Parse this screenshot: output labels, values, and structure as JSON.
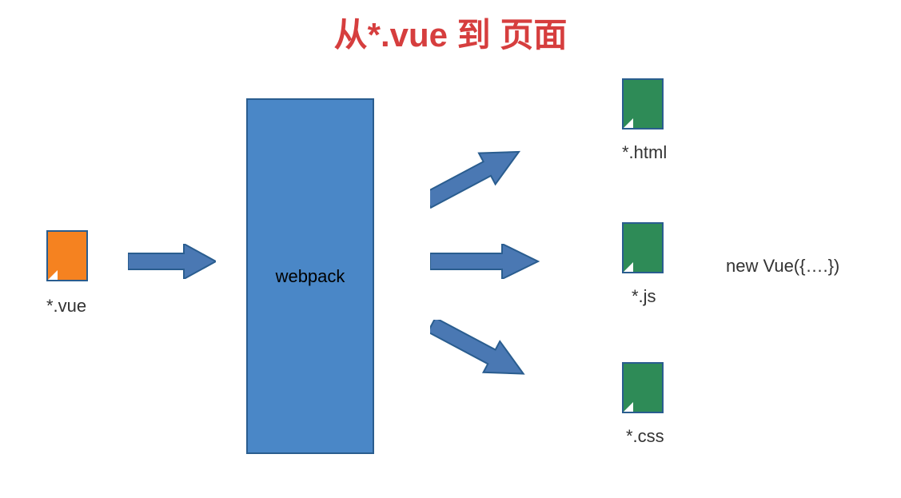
{
  "title": "从*.vue 到 页面",
  "input_label": "*.vue",
  "process_label": "webpack",
  "outputs": {
    "html": "*.html",
    "js": "*.js",
    "css": "*.css"
  },
  "annotation": "new Vue({….})",
  "colors": {
    "title_color": "#d63e3e",
    "orange": "#f58220",
    "green": "#2e8b57",
    "blue_fill": "#4a87c7",
    "blue_stroke": "#2a5d8f",
    "arrow_fill": "#4a78b3"
  }
}
